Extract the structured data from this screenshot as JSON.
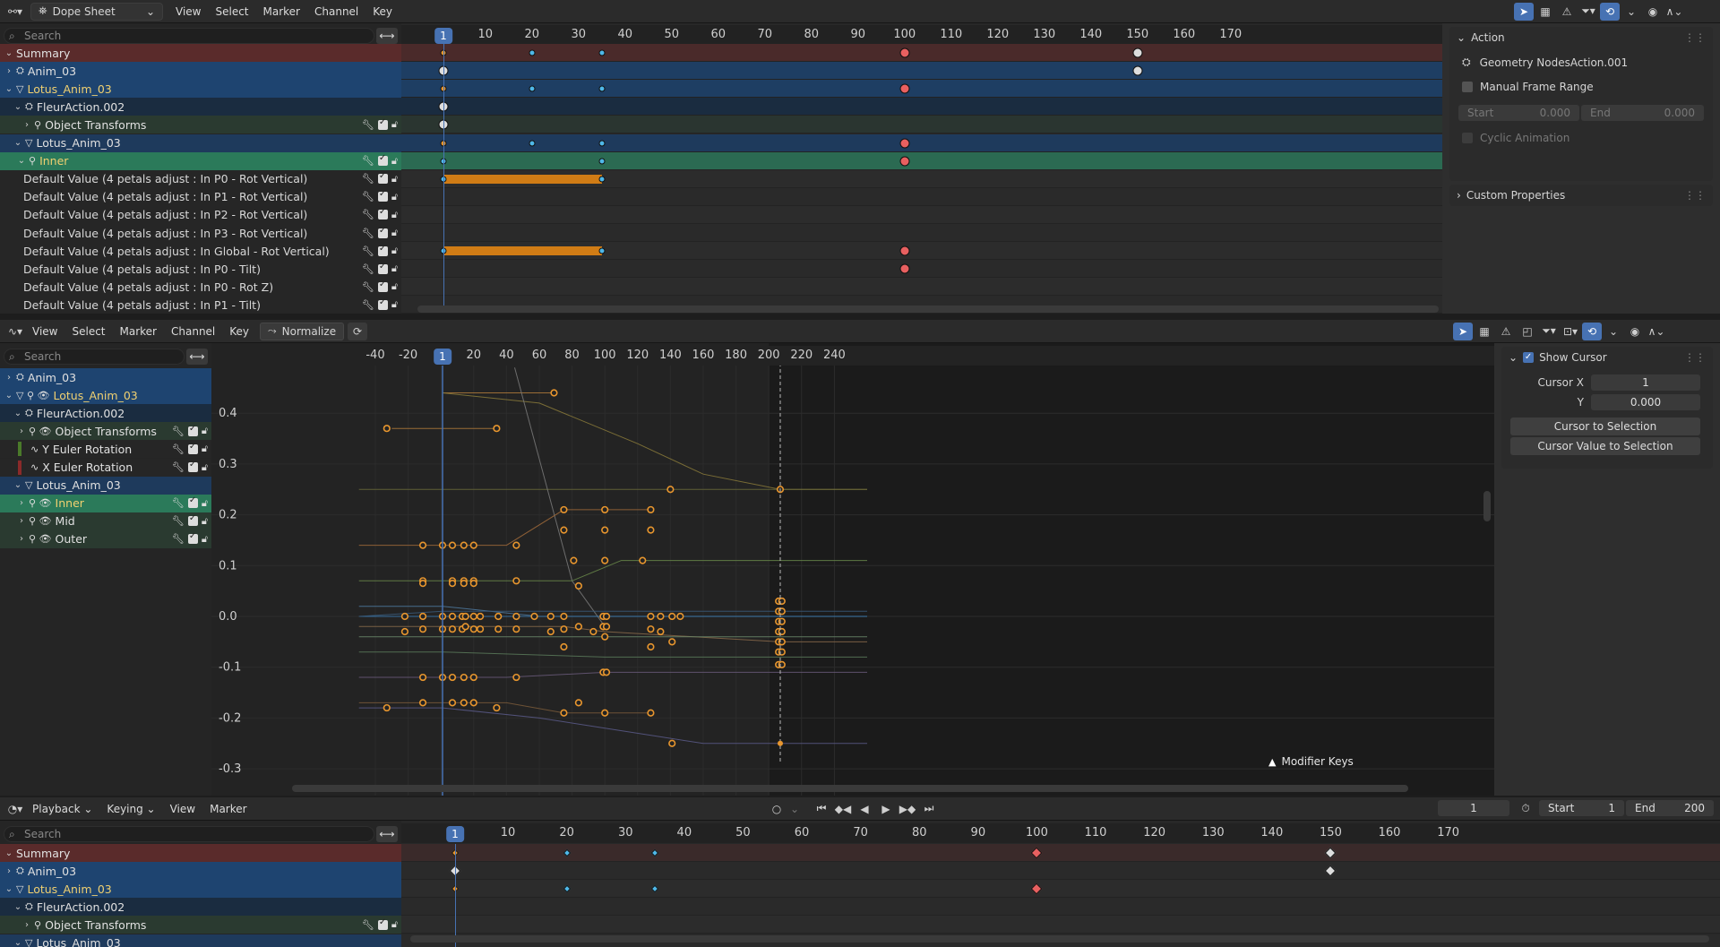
{
  "dope": {
    "editor": "Dope Sheet",
    "menus": [
      "View",
      "Select",
      "Marker",
      "Channel",
      "Key"
    ],
    "search_placeholder": "Search",
    "current_frame": "1",
    "ruler": [
      "10",
      "20",
      "30",
      "40",
      "50",
      "60",
      "70",
      "80",
      "90",
      "100",
      "110",
      "120",
      "130",
      "140",
      "150",
      "160",
      "170"
    ],
    "channels": [
      {
        "label": "Summary",
        "kind": "summary"
      },
      {
        "label": "Anim_03",
        "kind": "object"
      },
      {
        "label": "Lotus_Anim_03",
        "kind": "object2"
      },
      {
        "label": "FleurAction.002",
        "kind": "action"
      },
      {
        "label": "Object Transforms",
        "kind": "group"
      },
      {
        "label": "Lotus_Anim_03",
        "kind": "object3"
      },
      {
        "label": "Inner",
        "kind": "groupsel"
      },
      {
        "label": "Default Value (4 petals adjust : In P0 - Rot Vertical)",
        "kind": "fcurve"
      },
      {
        "label": "Default Value (4 petals adjust : In P1 - Rot Vertical)",
        "kind": "fcurve"
      },
      {
        "label": "Default Value (4 petals adjust : In P2 - Rot Vertical)",
        "kind": "fcurve"
      },
      {
        "label": "Default Value (4 petals adjust : In P3 - Rot Vertical)",
        "kind": "fcurve"
      },
      {
        "label": "Default Value (4 petals adjust : In Global - Rot Vertical)",
        "kind": "fcurve"
      },
      {
        "label": "Default Value (4 petals adjust : In P0 - Tilt)",
        "kind": "fcurve"
      },
      {
        "label": "Default Value (4 petals adjust : In P0 - Rot Z)",
        "kind": "fcurve"
      },
      {
        "label": "Default Value (4 petals adjust : In P1 - Tilt)",
        "kind": "fcurve"
      }
    ]
  },
  "sidebar": {
    "action_header": "Action",
    "action_name": "Geometry NodesAction.001",
    "manual_frame_range": "Manual Frame Range",
    "start_label": "Start",
    "start_value": "0.000",
    "end_label": "End",
    "end_value": "0.000",
    "cyclic": "Cyclic Animation",
    "custom_props": "Custom Properties"
  },
  "graph": {
    "menus": [
      "View",
      "Select",
      "Marker",
      "Channel",
      "Key"
    ],
    "normalize": "Normalize",
    "search_placeholder": "Search",
    "current_frame": "1",
    "ruler": [
      "-40",
      "-20",
      "20",
      "40",
      "60",
      "80",
      "100",
      "120",
      "140",
      "160",
      "180",
      "200",
      "220",
      "240"
    ],
    "y_labels": [
      "0.4",
      "0.3",
      "0.2",
      "0.1",
      "0.0",
      "-0.1",
      "-0.2",
      "-0.3"
    ],
    "channels": [
      {
        "label": "Anim_03"
      },
      {
        "label": "Lotus_Anim_03"
      },
      {
        "label": "FleurAction.002"
      },
      {
        "label": "Object Transforms"
      },
      {
        "label": "Y Euler Rotation"
      },
      {
        "label": "X Euler Rotation"
      },
      {
        "label": "Lotus_Anim_03"
      },
      {
        "label": "Inner"
      },
      {
        "label": "Mid"
      },
      {
        "label": "Outer"
      }
    ],
    "marker_label": "Modifier Keys",
    "cursor_panel": {
      "title": "Show Cursor",
      "cursor_x_label": "Cursor X",
      "cursor_x": "1",
      "y_label": "Y",
      "y_value": "0.000",
      "to_selection": "Cursor to Selection",
      "value_to_selection": "Cursor Value to Selection"
    }
  },
  "timeline": {
    "menus": [
      "Playback",
      "Keying",
      "View",
      "Marker"
    ],
    "current_frame_field": "1",
    "start_label": "Start",
    "start_value": "1",
    "end_label": "End",
    "end_value": "200",
    "search_placeholder": "Search",
    "current_frame": "1",
    "ruler": [
      "10",
      "20",
      "30",
      "40",
      "50",
      "60",
      "70",
      "80",
      "90",
      "100",
      "110",
      "120",
      "130",
      "140",
      "150",
      "160",
      "170"
    ],
    "channels": [
      {
        "label": "Summary",
        "kind": "summary"
      },
      {
        "label": "Anim_03",
        "kind": "object"
      },
      {
        "label": "Lotus_Anim_03",
        "kind": "object2"
      },
      {
        "label": "FleurAction.002",
        "kind": "action"
      },
      {
        "label": "Object Transforms",
        "kind": "group"
      },
      {
        "label": "Lotus_Anim_03",
        "kind": "object3"
      }
    ]
  },
  "colors": {
    "accent": "#4772b3",
    "keyframe_orange": "#e8962e",
    "keyframe_red": "#e06060",
    "keyframe_blue": "#4fb8e8",
    "summary_bg": "#5c2a2a",
    "object_bg": "#1f4a7a",
    "group_sel": "#2a7a5a"
  }
}
